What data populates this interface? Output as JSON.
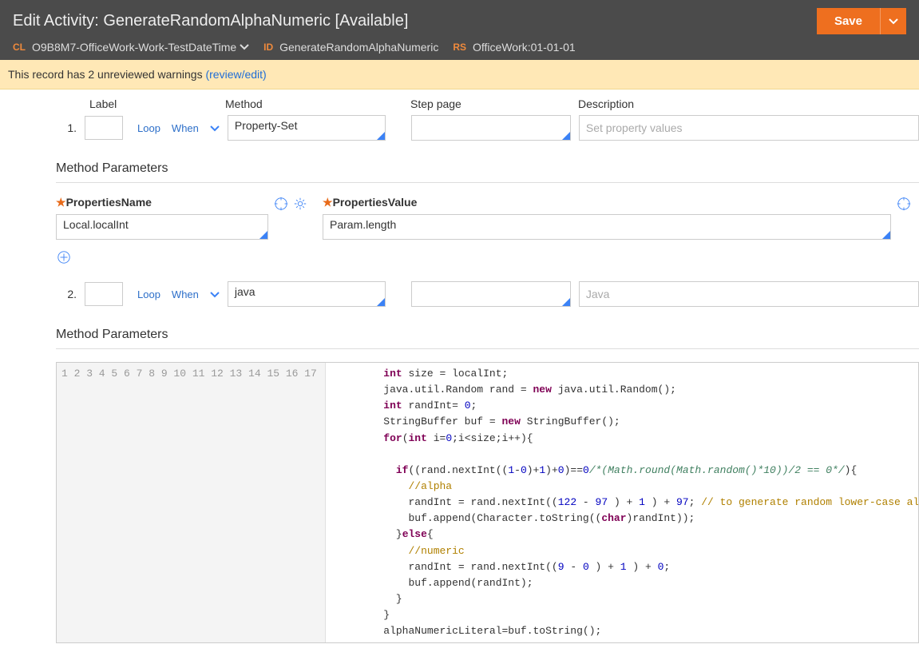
{
  "header": {
    "title": "Edit Activity: GenerateRandomAlphaNumeric [Available]",
    "save_label": "Save",
    "cl_label": "CL",
    "cl_value": "O9B8M7-OfficeWork-Work-TestDateTime",
    "id_label": "ID",
    "id_value": "GenerateRandomAlphaNumeric",
    "rs_label": "RS",
    "rs_value": "OfficeWork:01-01-01"
  },
  "warning": {
    "text": "This record has 2 unreviewed warnings ",
    "link": "(review/edit)"
  },
  "columns": {
    "label": "Label",
    "method": "Method",
    "step": "Step page",
    "description": "Description"
  },
  "links": {
    "loop": "Loop",
    "when": "When"
  },
  "step1": {
    "num": "1.",
    "method": "Property-Set",
    "step_page": "",
    "desc_placeholder": "Set property values",
    "section": "Method Parameters",
    "pn_label": "PropertiesName",
    "pn_value": "Local.localInt",
    "pv_label": "PropertiesValue",
    "pv_value": "Param.length"
  },
  "step2": {
    "num": "2.",
    "method": "java",
    "step_page": "",
    "desc_placeholder": "Java",
    "section": "Method Parameters"
  },
  "code": {
    "lines": [
      "1",
      "2",
      "3",
      "4",
      "5",
      "6",
      "7",
      "8",
      "9",
      "10",
      "11",
      "12",
      "13",
      "14",
      "15",
      "16",
      "17"
    ]
  }
}
